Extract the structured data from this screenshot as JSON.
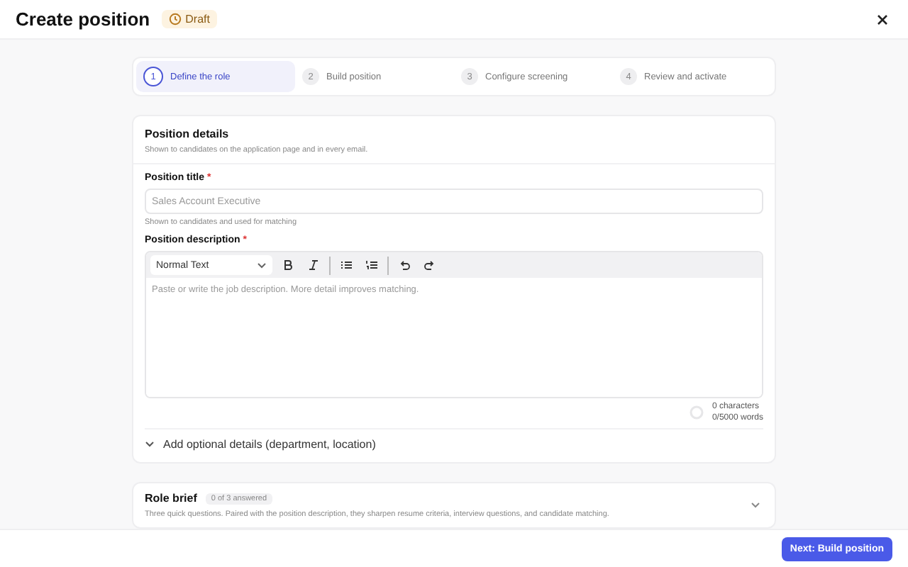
{
  "header": {
    "title": "Create position",
    "status_badge": "Draft"
  },
  "steps": [
    {
      "number": "1",
      "label": "Define the role",
      "selected": true
    },
    {
      "number": "2",
      "label": "Build position",
      "selected": false
    },
    {
      "number": "3",
      "label": "Configure screening",
      "selected": false
    },
    {
      "number": "4",
      "label": "Review and activate",
      "selected": false
    }
  ],
  "details": {
    "title": "Position details",
    "subtitle": "Shown to candidates on the application page and in every email.",
    "title_field": {
      "label": "Position title",
      "required_mark": "*",
      "placeholder": "Sales Account Executive",
      "hint": "Shown to candidates and used for matching"
    },
    "description_field": {
      "label": "Position description",
      "required_mark": "*",
      "format_select": "Normal Text",
      "placeholder": "Paste or write the job description. More detail improves matching.",
      "characters": "0 characters",
      "words": "0/5000 words"
    },
    "optional_toggle": {
      "label": "Add optional details (department, location)",
      "expanded": false
    }
  },
  "role_brief": {
    "title": "Role brief",
    "progress_badge": "0 of 3 answered",
    "subtitle": "Three quick questions. Paired with the position description, they sharpen resume criteria, interview questions, and candidate matching.",
    "expanded": false
  },
  "footer": {
    "primary_button": "Next: Build position"
  }
}
